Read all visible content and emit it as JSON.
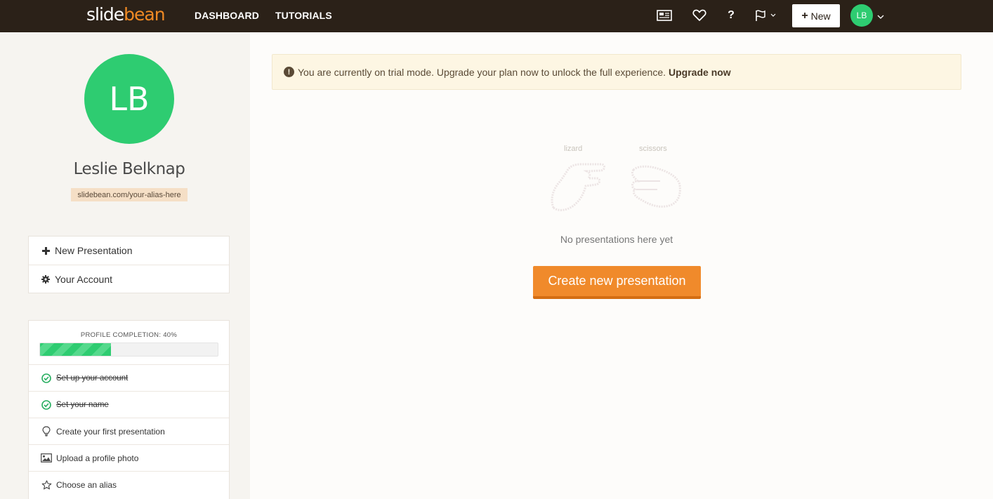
{
  "header": {
    "logo_slide": "slide",
    "logo_bean": "bean",
    "nav": {
      "dashboard": "DASHBOARD",
      "tutorials": "TUTORIALS"
    },
    "icons": [
      "newspaper-icon",
      "heart-icon",
      "help-icon",
      "flag-icon"
    ],
    "help_glyph": "?",
    "new_button": "New",
    "user_initials": "LB"
  },
  "sidebar": {
    "avatar_initials": "LB",
    "user_name": "Leslie Belknap",
    "alias_url": "slidebean.com/your-alias-here",
    "menu": [
      {
        "label": "New Presentation",
        "icon": "plus-icon"
      },
      {
        "label": "Your Account",
        "icon": "gear-icon"
      }
    ],
    "profile_completion": {
      "title": "PROFILE COMPLETION: 40%",
      "percent": 40,
      "tasks": [
        {
          "label": "Set up your account",
          "done": true,
          "icon": "check-circle-icon"
        },
        {
          "label": "Set your name",
          "done": true,
          "icon": "check-circle-icon"
        },
        {
          "label": "Create your first presentation",
          "done": false,
          "icon": "lightbulb-icon"
        },
        {
          "label": "Upload a profile photo",
          "done": false,
          "icon": "image-icon"
        },
        {
          "label": "Choose an alias",
          "done": false,
          "icon": "star-icon"
        }
      ]
    }
  },
  "main": {
    "banner": {
      "text": "You are currently on trial mode. Upgrade your plan now to unlock the full experience.",
      "link": "Upgrade now"
    },
    "illustration_labels": [
      "lizard",
      "scissors"
    ],
    "empty_text": "No presentations here yet",
    "create_button": "Create new presentation"
  },
  "colors": {
    "topbar": "#2b2118",
    "accent_orange": "#f08a2b",
    "avatar_green": "#2ecc71",
    "banner_bg": "#fdf6e3"
  }
}
